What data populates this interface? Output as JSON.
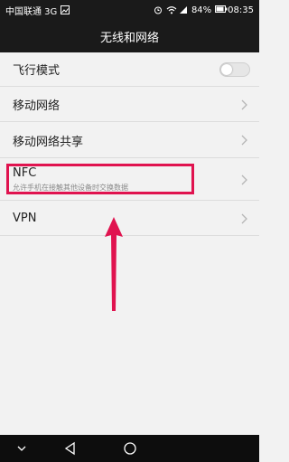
{
  "status_bar": {
    "carrier": "中国联通 3G",
    "battery": "84%",
    "time": "08:35"
  },
  "header": {
    "title": "无线和网络"
  },
  "settings": [
    {
      "label": "飞行模式",
      "control": "toggle",
      "toggle_on": false
    },
    {
      "label": "移动网络",
      "control": "chevron"
    },
    {
      "label": "移动网络共享",
      "control": "chevron"
    },
    {
      "label": "NFC",
      "sublabel": "允许手机在接触其他设备时交换数据",
      "control": "chevron"
    },
    {
      "label": "VPN",
      "control": "chevron"
    }
  ],
  "annotation_color": "#e0134f",
  "nav_icons": [
    "down-chevron-icon",
    "back-triangle-icon",
    "home-circle-icon"
  ]
}
